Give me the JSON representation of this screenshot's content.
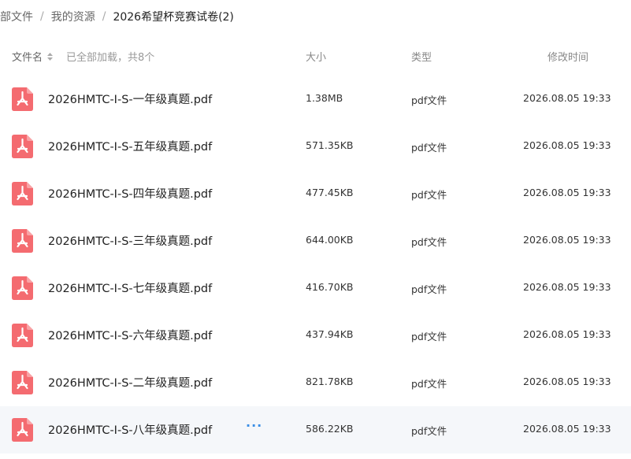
{
  "breadcrumb": {
    "items": [
      "部文件",
      "我的资源",
      "2026希望杯竞赛试卷(2)"
    ],
    "separator": "/"
  },
  "header": {
    "col_name": "文件名",
    "loaded_text": "已全部加载，共8个",
    "col_size": "大小",
    "col_type": "类型",
    "col_time": "修改时间"
  },
  "colors": {
    "pdf_icon": "#f46b70",
    "more_accent": "#3b8fe6",
    "hover_row": "#f5f7fa"
  },
  "files": [
    {
      "name": "2026HMTC-I-S-一年级真题.pdf",
      "size": "1.38MB",
      "type": "pdf文件",
      "time": "2026.08.05 19:33",
      "more": ""
    },
    {
      "name": "2026HMTC-I-S-五年级真题.pdf",
      "size": "571.35KB",
      "type": "pdf文件",
      "time": "2026.08.05 19:33",
      "more": ""
    },
    {
      "name": "2026HMTC-I-S-四年级真题.pdf",
      "size": "477.45KB",
      "type": "pdf文件",
      "time": "2026.08.05 19:33",
      "more": ""
    },
    {
      "name": "2026HMTC-I-S-三年级真题.pdf",
      "size": "644.00KB",
      "type": "pdf文件",
      "time": "2026.08.05 19:33",
      "more": ""
    },
    {
      "name": "2026HMTC-I-S-七年级真题.pdf",
      "size": "416.70KB",
      "type": "pdf文件",
      "time": "2026.08.05 19:33",
      "more": ""
    },
    {
      "name": "2026HMTC-I-S-六年级真题.pdf",
      "size": "437.94KB",
      "type": "pdf文件",
      "time": "2026.08.05 19:33",
      "more": ""
    },
    {
      "name": "2026HMTC-I-S-二年级真题.pdf",
      "size": "821.78KB",
      "type": "pdf文件",
      "time": "2026.08.05 19:33",
      "more": ""
    },
    {
      "name": "2026HMTC-I-S-八年级真题.pdf",
      "size": "586.22KB",
      "type": "pdf文件",
      "time": "2026.08.05 19:33",
      "more": "···"
    }
  ]
}
